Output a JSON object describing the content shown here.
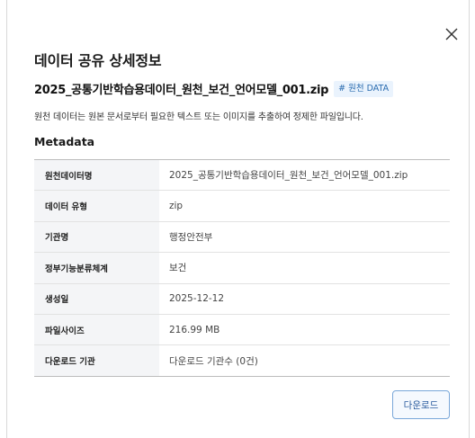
{
  "dialog": {
    "title": "데이터 공유 상세정보",
    "file_name": "2025_공통기반학습용데이터_원천_보건_언어모델_001.zip",
    "tag": "# 원천 DATA",
    "description": "원천 데이터는 원본 문서로부터 필요한 텍스트 또는 이미지를 추출하여 정제한 파일입니다.",
    "metadata_title": "Metadata",
    "download_label": "다운로드",
    "close_icon": "close-icon"
  },
  "metadata": [
    {
      "key": "원천데이터명",
      "value": "2025_공통기반학습용데이터_원천_보건_언어모델_001.zip"
    },
    {
      "key": "데이터 유형",
      "value": "zip"
    },
    {
      "key": "기관명",
      "value": "행정안전부"
    },
    {
      "key": "정부기능분류체계",
      "value": "보건"
    },
    {
      "key": "생성일",
      "value": "2025-12-12"
    },
    {
      "key": "파일사이즈",
      "value": "216.99 MB"
    },
    {
      "key": "다운로드 기관",
      "value": "다운로드 기관수 (0건)"
    }
  ],
  "colors": {
    "tag_bg": "#eaf3fd",
    "tag_text": "#2b6cb0",
    "key_bg": "#f4f5f7",
    "button_border": "#7aa7d9",
    "button_text": "#2b5c9e"
  }
}
